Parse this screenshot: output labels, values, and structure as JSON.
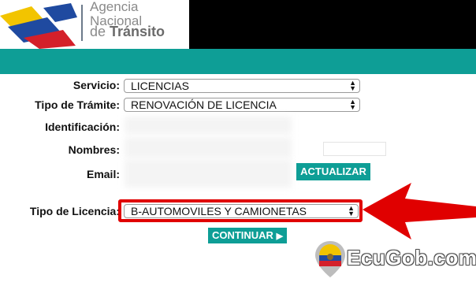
{
  "logo": {
    "line1": "Agencia",
    "line2": "Nacional",
    "line3_prefix": "de ",
    "line3_bold": "Tránsito"
  },
  "form": {
    "servicio_label": "Servicio:",
    "servicio_value": "LICENCIAS",
    "tramite_label": "Tipo de Trámite:",
    "tramite_value": "RENOVACIÓN DE LICENCIA",
    "identificacion_label": "Identificación:",
    "nombres_label": "Nombres:",
    "email_label": "Email:",
    "actualizar_label": "ACTUALIZAR",
    "licencia_label": "Tipo de Licencia:",
    "licencia_value": "B-AUTOMOVILES Y CAMIONETAS",
    "continuar_label": "CONTINUAR"
  },
  "watermark": {
    "text": "EcuGob.com"
  },
  "colors": {
    "teal": "#0e9e96",
    "highlight_red": "#e00000",
    "header_black": "#000000"
  },
  "icons": [
    "chevron-updown-icon",
    "play-arrow-icon",
    "red-arrow-icon",
    "map-pin-flag-icon",
    "logo-swoosh-icon"
  ]
}
